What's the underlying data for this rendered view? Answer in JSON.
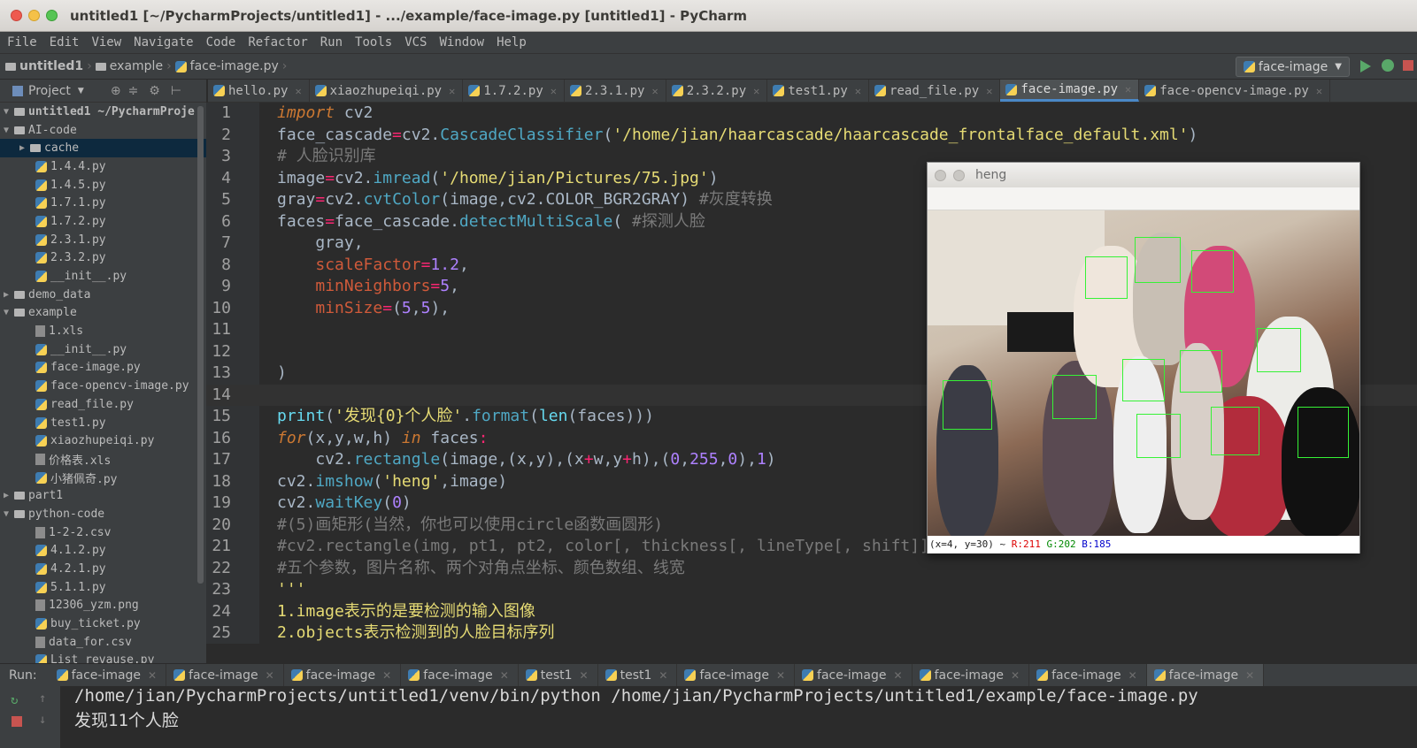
{
  "window": {
    "title": "untitled1 [~/PycharmProjects/untitled1] - .../example/face-image.py [untitled1] - PyCharm"
  },
  "menu": [
    "File",
    "Edit",
    "View",
    "Navigate",
    "Code",
    "Refactor",
    "Run",
    "Tools",
    "VCS",
    "Window",
    "Help"
  ],
  "breadcrumb": [
    "untitled1",
    "example",
    "face-image.py"
  ],
  "run_config": "face-image",
  "project_header": "Project",
  "tabs": [
    {
      "label": "hello.py",
      "active": false
    },
    {
      "label": "xiaozhupeiqi.py",
      "active": false
    },
    {
      "label": "1.7.2.py",
      "active": false
    },
    {
      "label": "2.3.1.py",
      "active": false
    },
    {
      "label": "2.3.2.py",
      "active": false
    },
    {
      "label": "test1.py",
      "active": false
    },
    {
      "label": "read_file.py",
      "active": false
    },
    {
      "label": "face-image.py",
      "active": true
    },
    {
      "label": "face-opencv-image.py",
      "active": false
    }
  ],
  "tree": [
    {
      "label": "untitled1  ~/PycharmProje",
      "indent": 0,
      "type": "root",
      "open": true
    },
    {
      "label": "AI-code",
      "indent": 0,
      "type": "folder",
      "open": true
    },
    {
      "label": "cache",
      "indent": 1,
      "type": "folder",
      "open": false,
      "selected": true
    },
    {
      "label": "1.4.4.py",
      "indent": 2,
      "type": "py"
    },
    {
      "label": "1.4.5.py",
      "indent": 2,
      "type": "py"
    },
    {
      "label": "1.7.1.py",
      "indent": 2,
      "type": "py"
    },
    {
      "label": "1.7.2.py",
      "indent": 2,
      "type": "py"
    },
    {
      "label": "2.3.1.py",
      "indent": 2,
      "type": "py"
    },
    {
      "label": "2.3.2.py",
      "indent": 2,
      "type": "py"
    },
    {
      "label": "__init__.py",
      "indent": 2,
      "type": "py"
    },
    {
      "label": "demo_data",
      "indent": 0,
      "type": "folder",
      "open": false
    },
    {
      "label": "example",
      "indent": 0,
      "type": "folder",
      "open": true
    },
    {
      "label": "1.xls",
      "indent": 2,
      "type": "file"
    },
    {
      "label": "__init__.py",
      "indent": 2,
      "type": "py"
    },
    {
      "label": "face-image.py",
      "indent": 2,
      "type": "py"
    },
    {
      "label": "face-opencv-image.py",
      "indent": 2,
      "type": "py"
    },
    {
      "label": "read_file.py",
      "indent": 2,
      "type": "py"
    },
    {
      "label": "test1.py",
      "indent": 2,
      "type": "py"
    },
    {
      "label": "xiaozhupeiqi.py",
      "indent": 2,
      "type": "py"
    },
    {
      "label": "价格表.xls",
      "indent": 2,
      "type": "file"
    },
    {
      "label": "小猪佩奇.py",
      "indent": 2,
      "type": "py"
    },
    {
      "label": "part1",
      "indent": 0,
      "type": "folder",
      "open": false
    },
    {
      "label": "python-code",
      "indent": 0,
      "type": "folder",
      "open": true
    },
    {
      "label": "1-2-2.csv",
      "indent": 2,
      "type": "file"
    },
    {
      "label": "4.1.2.py",
      "indent": 2,
      "type": "py"
    },
    {
      "label": "4.2.1.py",
      "indent": 2,
      "type": "py"
    },
    {
      "label": "5.1.1.py",
      "indent": 2,
      "type": "py"
    },
    {
      "label": "12306_yzm.png",
      "indent": 2,
      "type": "file"
    },
    {
      "label": "buy_ticket.py",
      "indent": 2,
      "type": "py"
    },
    {
      "label": "data_for.csv",
      "indent": 2,
      "type": "file"
    },
    {
      "label": "List_revause.py",
      "indent": 2,
      "type": "py"
    }
  ],
  "line_numbers": [
    "1",
    "2",
    "3",
    "4",
    "5",
    "6",
    "7",
    "8",
    "9",
    "10",
    "11",
    "12",
    "13",
    "14",
    "15",
    "16",
    "17",
    "18",
    "19",
    "20",
    "21",
    "22",
    "23",
    "24",
    "25"
  ],
  "image_window": {
    "title": "heng",
    "status_prefix": "(x=4, y=30) ~ ",
    "r": "R:211",
    "g": "G:202",
    "b": "B:185"
  },
  "run_panel": {
    "label": "Run:",
    "tabs": [
      "face-image",
      "face-image",
      "face-image",
      "face-image",
      "test1",
      "test1",
      "face-image",
      "face-image",
      "face-image",
      "face-image",
      "face-image"
    ],
    "active_tab": 10,
    "lines": [
      "/home/jian/PycharmProjects/untitled1/venv/bin/python /home/jian/PycharmProjects/untitled1/example/face-image.py",
      "发现11个人脸"
    ]
  }
}
